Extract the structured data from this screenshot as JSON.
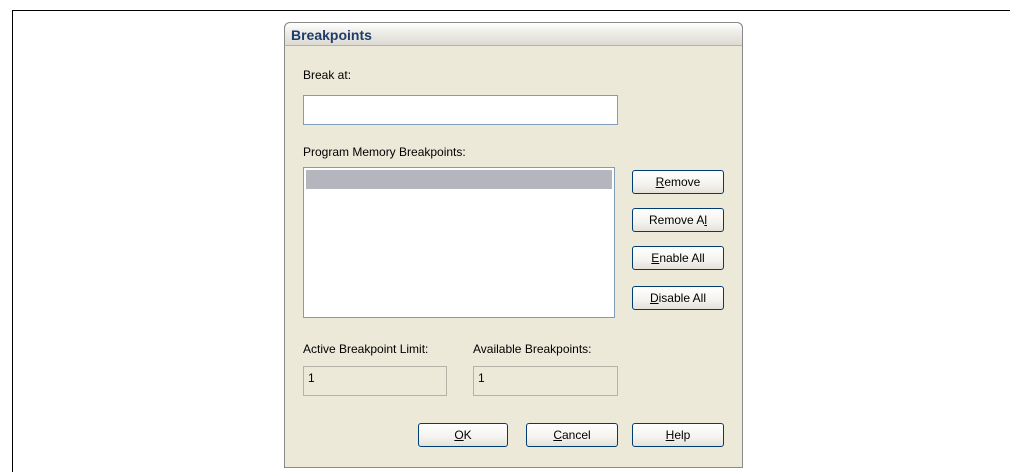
{
  "dialog": {
    "title": "Breakpoints"
  },
  "break_at": {
    "label": "Break at:",
    "value": ""
  },
  "list": {
    "label": "Program Memory Breakpoints:",
    "items": [
      ""
    ]
  },
  "side_buttons": {
    "remove": {
      "mnemonic": "R",
      "rest": "emove"
    },
    "remove_all": {
      "pre": "Remove A",
      "mnemonic": "l",
      "rest": "l"
    },
    "enable_all": {
      "mnemonic": "E",
      "rest": "nable All"
    },
    "disable_all": {
      "mnemonic": "D",
      "rest": "isable All"
    }
  },
  "limits": {
    "active_label": "Active Breakpoint Limit:",
    "active_value": "1",
    "available_label": "Available Breakpoints:",
    "available_value": "1"
  },
  "bottom_buttons": {
    "ok": {
      "mnemonic": "O",
      "rest": "K"
    },
    "cancel": {
      "mnemonic": "C",
      "rest": "ancel"
    },
    "help": {
      "mnemonic": "H",
      "rest": "elp"
    }
  },
  "colors": {
    "dialog_bg": "#ece9d8",
    "title_text": "#1f3d6b",
    "button_border": "#003c74",
    "selection": "#b5b5bd"
  }
}
